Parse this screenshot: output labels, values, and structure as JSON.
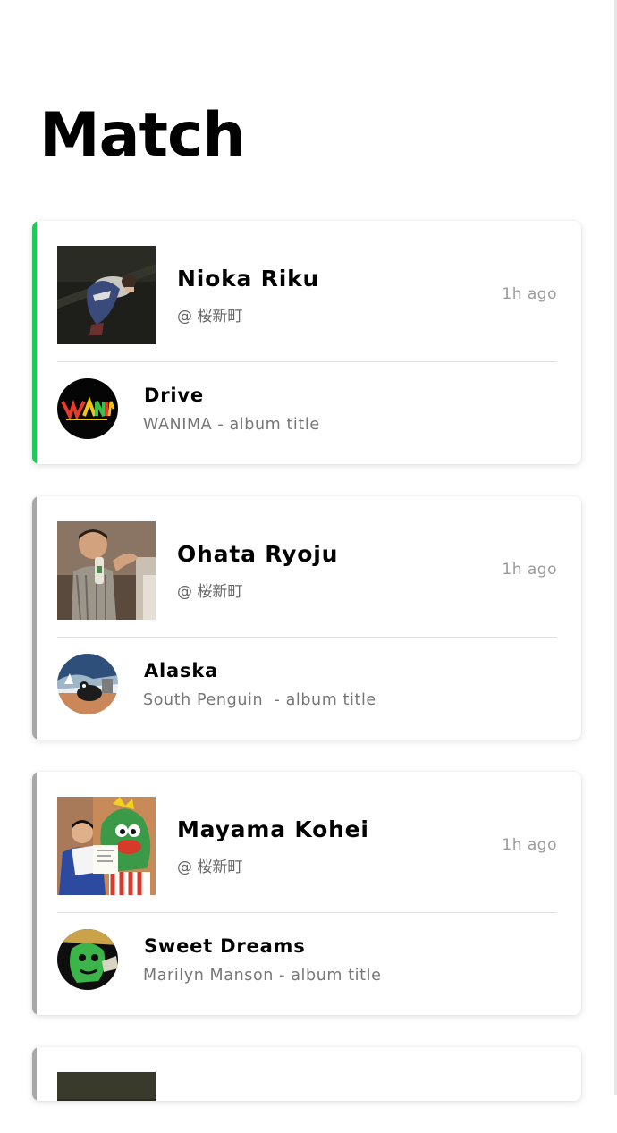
{
  "page": {
    "title": "Match"
  },
  "colors": {
    "active_accent": "#1fc95a",
    "inactive_accent": "#a8a8a8",
    "timestamp": "#9b9b9b"
  },
  "matches": [
    {
      "name": "Nioka Riku",
      "location": "@ 桜新町",
      "time": "1h ago",
      "accent": "active",
      "photo_icon": "user-photo",
      "song": {
        "title": "Drive",
        "meta": "WANIMA - album title",
        "art_icon": "wanima-album-art"
      }
    },
    {
      "name": "Ohata Ryoju",
      "location": "@ 桜新町",
      "time": "1h ago",
      "accent": "inactive",
      "photo_icon": "user-photo",
      "song": {
        "title": "Alaska",
        "meta": "South Penguin  - album title",
        "art_icon": "south-penguin-album-art"
      }
    },
    {
      "name": "Mayama Kohei",
      "location": "@ 桜新町",
      "time": "1h ago",
      "accent": "inactive",
      "photo_icon": "user-photo",
      "song": {
        "title": "Sweet Dreams",
        "meta": "Marilyn Manson - album title",
        "art_icon": "marilyn-manson-album-art"
      }
    }
  ]
}
